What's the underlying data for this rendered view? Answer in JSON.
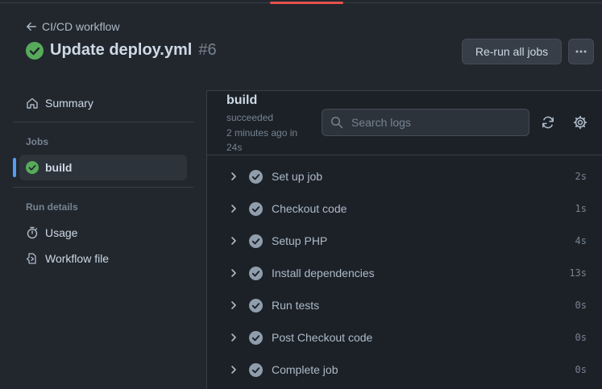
{
  "back_link": "CI/CD workflow",
  "run": {
    "title": "Update deploy.yml",
    "number": "#6"
  },
  "actions": {
    "rerun_label": "Re-run all jobs"
  },
  "sidebar": {
    "summary_label": "Summary",
    "jobs_heading": "Jobs",
    "jobs": [
      {
        "label": "build"
      }
    ],
    "run_details_heading": "Run details",
    "details": [
      {
        "label": "Usage",
        "icon": "stopwatch-icon"
      },
      {
        "label": "Workflow file",
        "icon": "file-code-icon"
      }
    ]
  },
  "job": {
    "name": "build",
    "status": "succeeded",
    "time": "2 minutes ago in 24s",
    "search_placeholder": "Search logs",
    "steps": [
      {
        "label": "Set up job",
        "duration": "2s"
      },
      {
        "label": "Checkout code",
        "duration": "1s"
      },
      {
        "label": "Setup PHP",
        "duration": "4s"
      },
      {
        "label": "Install dependencies",
        "duration": "13s"
      },
      {
        "label": "Run tests",
        "duration": "0s"
      },
      {
        "label": "Post Checkout code",
        "duration": "0s"
      },
      {
        "label": "Complete job",
        "duration": "0s"
      }
    ]
  },
  "colors": {
    "success": "#57ab5a",
    "accent": "#539bf5",
    "danger": "#e5534b"
  }
}
